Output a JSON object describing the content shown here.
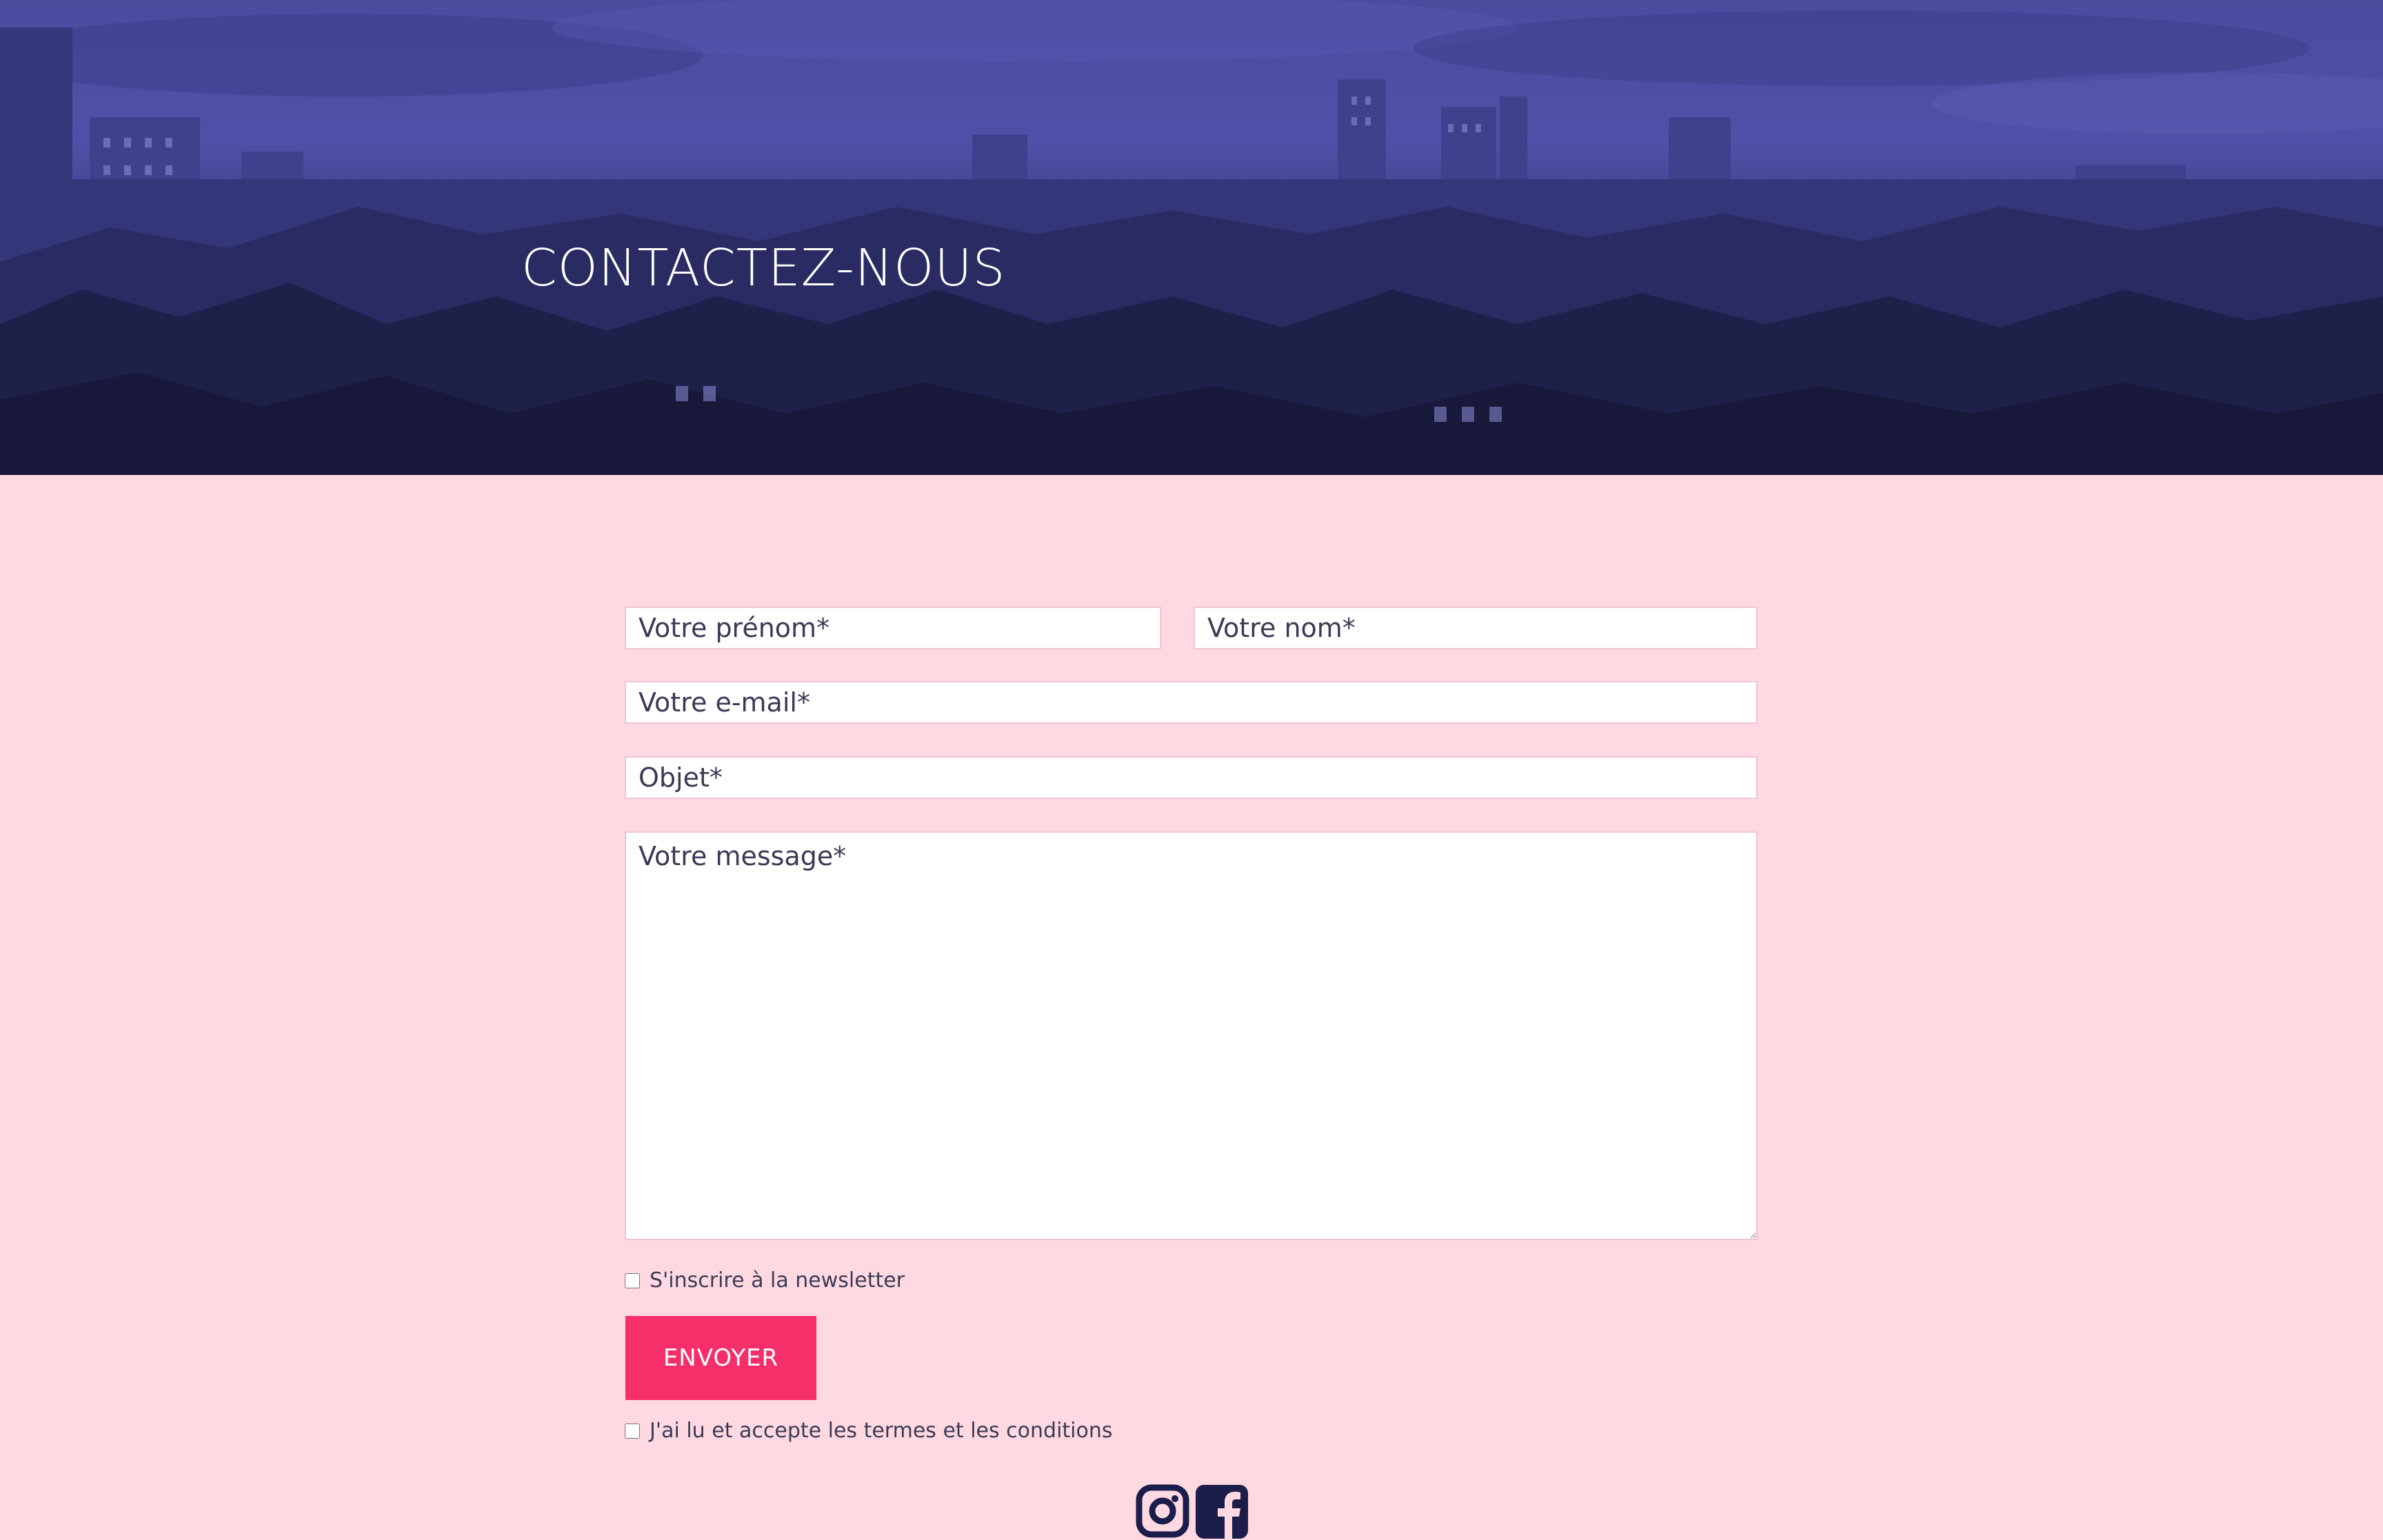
{
  "hero": {
    "title": "CONTACTEZ-NOUS"
  },
  "form": {
    "firstname_placeholder": "Votre prénom*",
    "lastname_placeholder": "Votre nom*",
    "email_placeholder": "Votre e-mail*",
    "subject_placeholder": "Objet*",
    "message_placeholder": "Votre message*",
    "newsletter_label": "S'inscrire à la newsletter",
    "submit_label": "ENVOYER",
    "terms_label": "J'ai lu et accepte les termes et les conditions"
  },
  "social": {
    "icons": [
      "instagram-icon",
      "facebook-icon"
    ],
    "icon_color": "#1b1d4a"
  },
  "colors": {
    "page_background": "#ffd9e1",
    "hero_tint": "#4f51a8",
    "button_background": "#f62e69",
    "button_text": "#ffffff"
  }
}
